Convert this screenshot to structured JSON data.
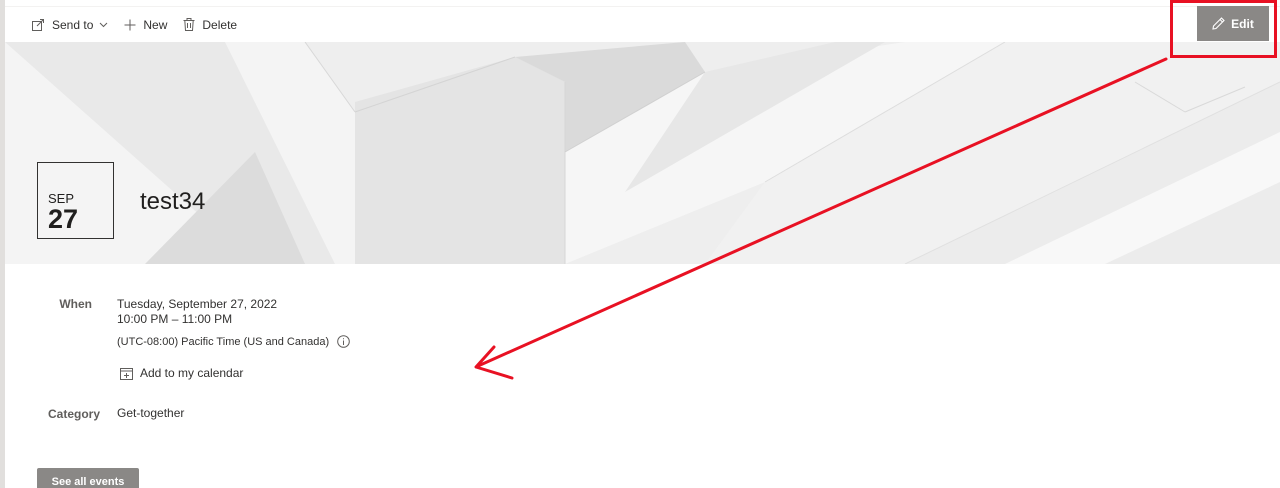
{
  "command_bar": {
    "send_to_label": "Send to",
    "new_label": "New",
    "delete_label": "Delete",
    "edit_label": "Edit"
  },
  "event": {
    "month": "SEP",
    "day": "27",
    "title": "test34"
  },
  "details": {
    "when_label": "When",
    "date_text": "Tuesday, September 27, 2022",
    "time_text": "10:00 PM – 11:00 PM",
    "timezone_text": "(UTC-08:00) Pacific Time (US and Canada)",
    "add_to_calendar_label": "Add to my calendar",
    "category_label": "Category",
    "category_value": "Get-together"
  },
  "footer": {
    "see_all_label": "See all events"
  },
  "colors": {
    "annotation_red": "#e81123",
    "button_gray": "#8a8886"
  }
}
